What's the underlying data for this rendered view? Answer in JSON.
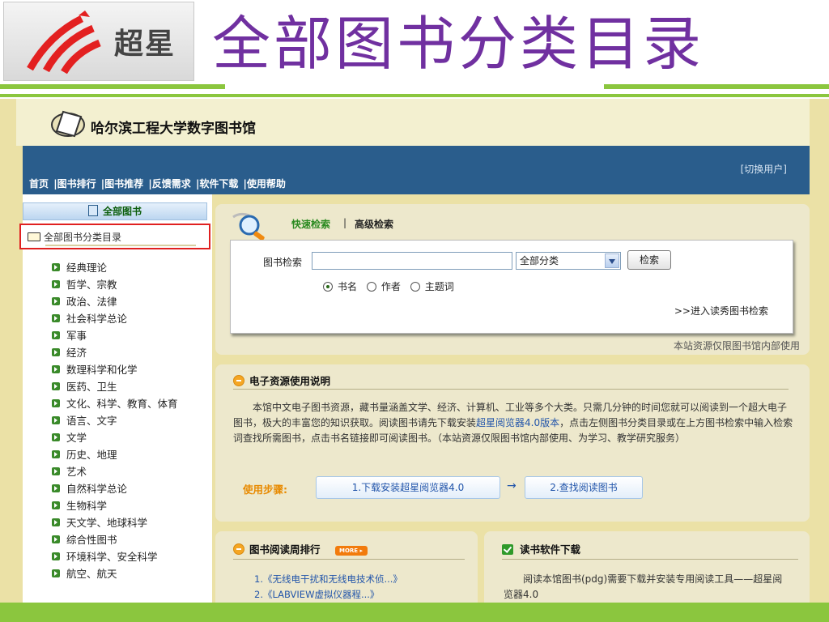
{
  "slide": {
    "logo_text": "超星",
    "title": "全部图书分类目录"
  },
  "library": {
    "name": "哈尔滨工程大学数字图书馆",
    "switch_user": "[切换用户]",
    "nav": [
      "首页",
      "|图书排行",
      "|图书推荐",
      "|反馈需求",
      "|软件下载",
      "|使用帮助"
    ]
  },
  "sidebar": {
    "header": "全部图书",
    "directory": "全部图书分类目录",
    "categories": [
      "经典理论",
      "哲学、宗教",
      "政治、法律",
      "社会科学总论",
      "军事",
      "经济",
      "数理科学和化学",
      "医药、卫生",
      "文化、科学、教育、体育",
      "语言、文字",
      "文学",
      "历史、地理",
      "艺术",
      "自然科学总论",
      "生物科学",
      "天文学、地球科学",
      "综合性图书",
      "环境科学、安全科学",
      "航空、航天"
    ]
  },
  "search": {
    "tab_quick": "快速检索",
    "tab_sep": "|",
    "tab_advanced": "高级检索",
    "label": "图书检索",
    "input_value": "",
    "category_selected": "全部分类",
    "button": "检索",
    "radio_options": [
      "书名",
      "作者",
      "主题词"
    ],
    "radio_selected": "书名",
    "reader_link": ">>进入读秀图书检索",
    "note": "本站资源仅限图书馆内部使用"
  },
  "eresource": {
    "title": "电子资源使用说明",
    "text_1": "本馆中文电子图书资源，藏书量涵盖文学、经济、计算机、工业等多个大类。只需几分钟的时间您就可以阅读到一个超大电子图书，极大的丰富您的知识获取。阅读图书请先下载安装",
    "text_link": "超星阅览器4.0版本",
    "text_2": "，点击左侧图书分类目录或在上方图书检索中输入检索词查找所需图书，点击书名链接即可阅读图书。（本站资源仅限图书馆内部使用、为学习、教学研究服务）",
    "steps_label": "使用步骤:",
    "step1": "1.下载安装超星阅览器4.0",
    "step_arrow": "→",
    "step2": "2.查找阅读图书"
  },
  "ranking": {
    "title": "图书阅读周排行",
    "more": "MORE ▸",
    "items": [
      "1.《无线电干扰和无线电技术侦...》",
      "2.《LABVIEW虚拟仪器程...》"
    ]
  },
  "download": {
    "title": "读书软件下载",
    "text": "阅读本馆图书(pdg)需要下载并安装专用阅读工具——超星阅览器4.0"
  },
  "colors": {
    "title_purple": "#7030a0",
    "accent_green": "#8bc63e",
    "nav_blue": "#2a5d8c",
    "highlight_red": "#e02020"
  }
}
